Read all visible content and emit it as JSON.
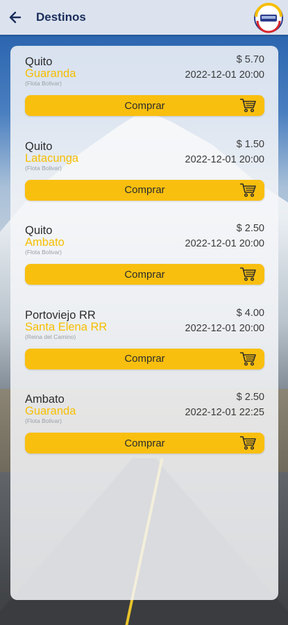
{
  "header": {
    "title": "Destinos",
    "back_icon": "arrow-left-icon",
    "logo_icon": "company-logo"
  },
  "colors": {
    "header_bg": "#dce3ee",
    "title": "#1a2c5a",
    "accent_yellow": "#f9bf0f",
    "destination_text": "#f6be00"
  },
  "trips": [
    {
      "origin": "Quito",
      "destination": "Guaranda",
      "company": "(Flota Bolivar)",
      "price": "$ 5.70",
      "datetime": "2022-12-01 20:00",
      "button": "Comprar"
    },
    {
      "origin": "Quito",
      "destination": "Latacunga",
      "company": "(Flota Bolivar)",
      "price": "$ 1.50",
      "datetime": "2022-12-01 20:00",
      "button": "Comprar"
    },
    {
      "origin": "Quito",
      "destination": "Ambato",
      "company": "(Flota Bolivar)",
      "price": "$ 2.50",
      "datetime": "2022-12-01 20:00",
      "button": "Comprar"
    },
    {
      "origin": "Portoviejo RR",
      "destination": "Santa Elena RR",
      "company": "(Reina del Camino)",
      "price": "$ 4.00",
      "datetime": "2022-12-01 20:00",
      "button": "Comprar"
    },
    {
      "origin": "Ambato",
      "destination": "Guaranda",
      "company": "(Flota Bolivar)",
      "price": "$ 2.50",
      "datetime": "2022-12-01 22:25",
      "button": "Comprar"
    }
  ]
}
